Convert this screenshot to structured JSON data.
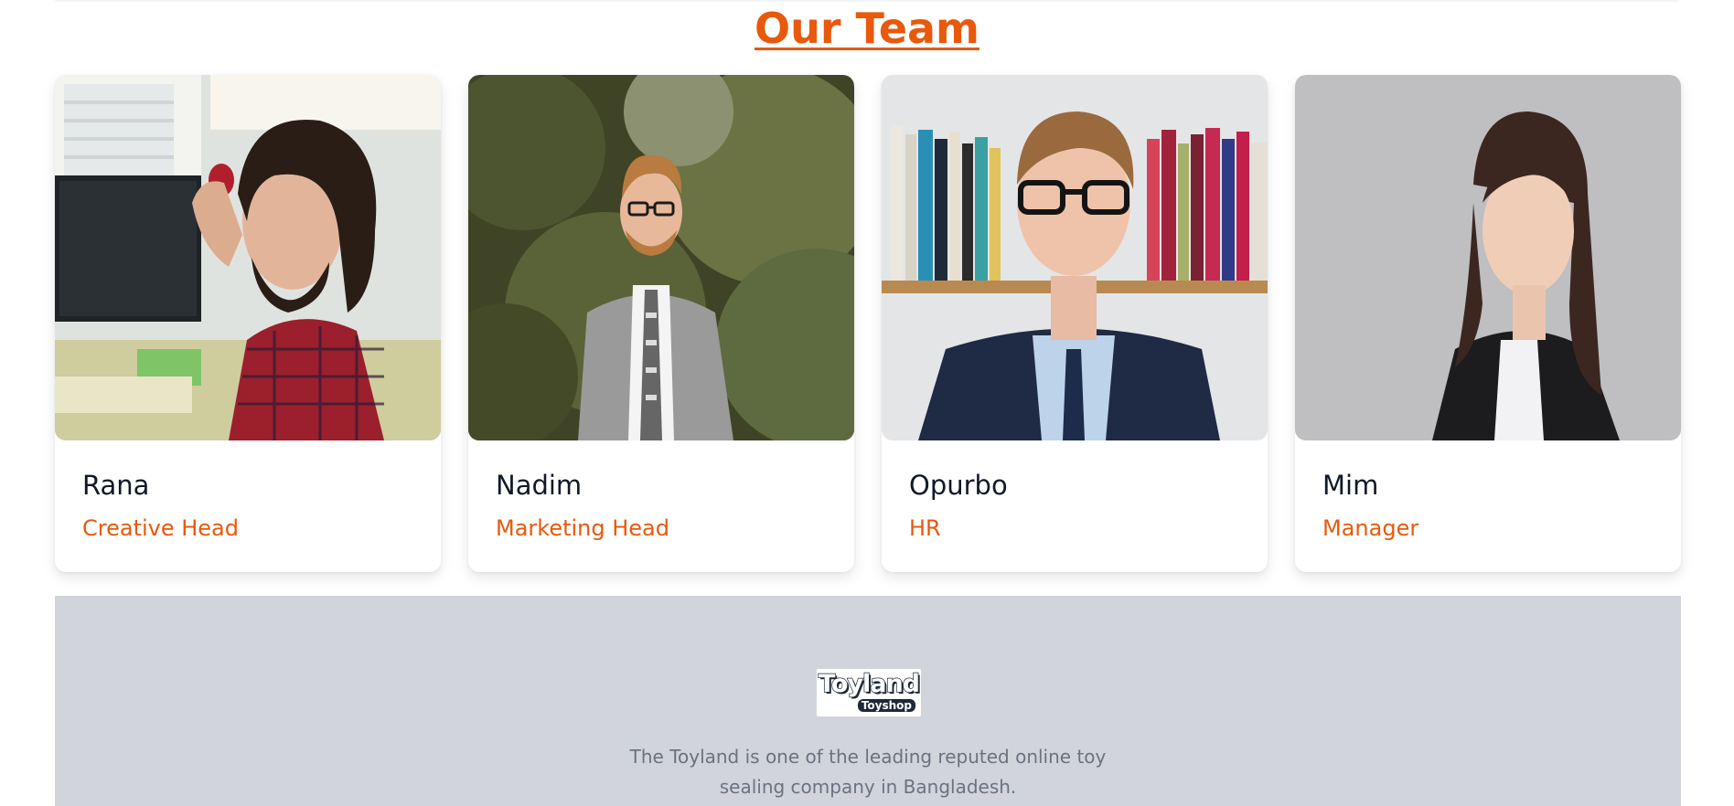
{
  "section": {
    "title": "Our Team"
  },
  "team": [
    {
      "name": "Rana",
      "role": "Creative Head"
    },
    {
      "name": "Nadim",
      "role": "Marketing Head"
    },
    {
      "name": "Opurbo",
      "role": "HR"
    },
    {
      "name": "Mim",
      "role": "Manager"
    }
  ],
  "footer": {
    "logo_text": "Toyland",
    "logo_subtext": "Toyshop",
    "about": "The Toyland is one of the leading reputed online toy sealing company in Bangladesh."
  },
  "colors": {
    "accent": "#e8590c",
    "footer_bg": "#d1d5db",
    "heading": "#111827",
    "muted": "#6b7280"
  }
}
